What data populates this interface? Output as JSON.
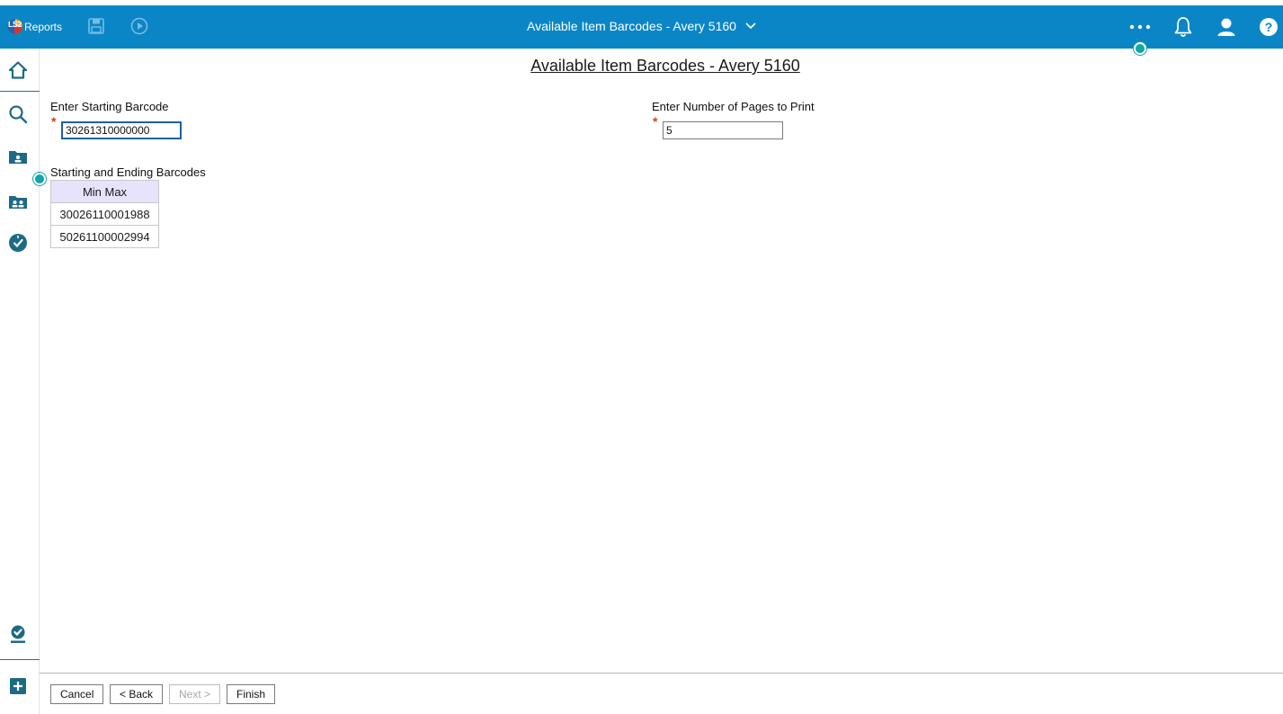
{
  "app": {
    "logo_badge": "LS2",
    "logo_text": "Reports",
    "title": "Available Item Barcodes - Avery 5160",
    "accent_color": "#0a86c7"
  },
  "toolbar": {
    "icons": [
      "save-icon",
      "play-icon"
    ]
  },
  "header_right": {
    "icons": [
      "more-icon",
      "bell-icon",
      "user-icon",
      "help-icon"
    ]
  },
  "sidebar": {
    "icons": [
      "home-icon",
      "search-icon",
      "patron-folder-icon",
      "patrons-icon",
      "checkout-icon",
      "task-check-icon",
      "add-icon"
    ]
  },
  "form": {
    "heading": "Available Item Barcodes - Avery 5160",
    "starting_barcode": {
      "label": "Enter Starting Barcode",
      "value": "30261310000000",
      "required_mark": "*"
    },
    "pages_to_print": {
      "label": "Enter Number of Pages to Print",
      "value": "5",
      "required_mark": "*"
    },
    "range_table": {
      "label": "Starting and Ending Barcodes",
      "header": "Min Max",
      "rows": [
        "30026110001988",
        "50261100002994"
      ]
    }
  },
  "footer": {
    "cancel": "Cancel",
    "back": "< Back",
    "next": "Next >",
    "finish": "Finish"
  }
}
